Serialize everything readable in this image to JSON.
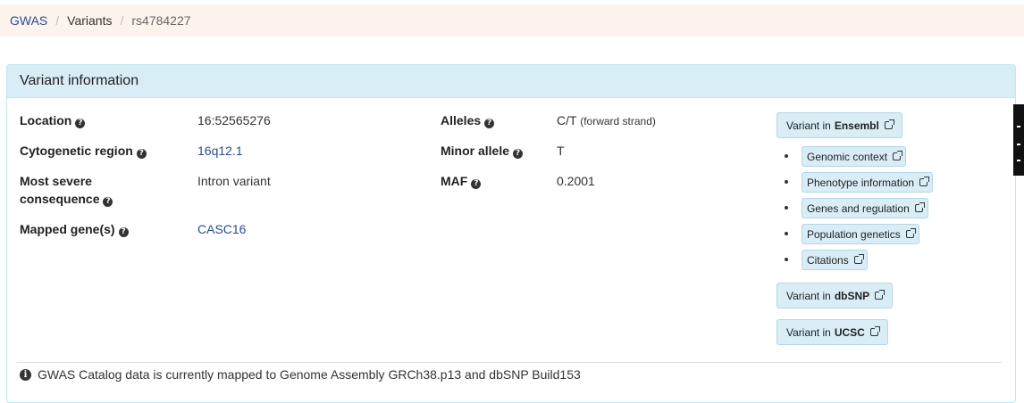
{
  "breadcrumb": {
    "home": "GWAS",
    "section": "Variants",
    "current": "rs4784227",
    "separator": "/"
  },
  "panel": {
    "title": "Variant information"
  },
  "fields": {
    "location": {
      "label": "Location",
      "value": "16:52565276"
    },
    "cytogenetic": {
      "label": "Cytogenetic region",
      "value": "16q12.1"
    },
    "consequence": {
      "label_line1": "Most severe",
      "label_line2": "consequence",
      "value": "Intron variant"
    },
    "mapped_genes": {
      "label": "Mapped gene(s)",
      "value": "CASC16"
    },
    "alleles": {
      "label": "Alleles",
      "value": "C/T",
      "note": "(forward strand)"
    },
    "minor_allele": {
      "label": "Minor allele",
      "value": "T"
    },
    "maf": {
      "label": "MAF",
      "value": "0.2001"
    }
  },
  "external_links": {
    "ensembl": {
      "prefix": "Variant in",
      "name": "Ensembl"
    },
    "ensembl_sub": [
      "Genomic context",
      "Phenotype information",
      "Genes and regulation",
      "Population genetics",
      "Citations"
    ],
    "dbsnp": {
      "prefix": "Variant in",
      "name": "dbSNP"
    },
    "ucsc": {
      "prefix": "Variant in",
      "name": "UCSC"
    }
  },
  "footer": {
    "note": "GWAS Catalog data is currently mapped to Genome Assembly GRCh38.p13 and dbSNP Build153"
  },
  "icons": {
    "help": "question-circle-icon",
    "external": "external-link-icon",
    "info": "info-circle-icon"
  },
  "colors": {
    "link": "#2a4d8f",
    "panel_heading_bg": "#d9edf7",
    "breadcrumb_bg": "#fcf3ec"
  }
}
